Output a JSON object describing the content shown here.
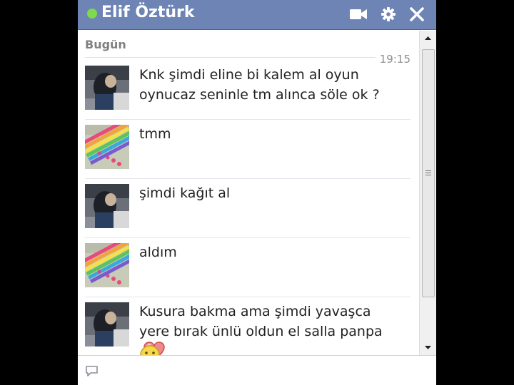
{
  "window": {
    "contact_name": "Elif Öztürk",
    "status": "online",
    "status_color": "#7fd94c",
    "header_color": "#6d84b4"
  },
  "toolbar": {
    "video_icon": "video-camera-icon",
    "settings_icon": "gear-icon",
    "close_icon": "close-icon"
  },
  "conversation": {
    "day_label": "Bugün",
    "timestamp": "19:15",
    "messages": [
      {
        "sender": "friend",
        "text": "Knk şimdi eline bi kalem al oyun oynucaz seninle tm alınca söle ok ?"
      },
      {
        "sender": "me",
        "text": "tmm"
      },
      {
        "sender": "friend",
        "text": "şimdi kağıt al"
      },
      {
        "sender": "me",
        "text": "aldım"
      },
      {
        "sender": "friend",
        "text": "Kusura bakma ama şimdi yavaşca yere bırak ünlü oldun el salla panpa",
        "emoji": [
          "heart-icon",
          "smiley-icon"
        ]
      }
    ]
  },
  "compose": {
    "placeholder": ""
  }
}
